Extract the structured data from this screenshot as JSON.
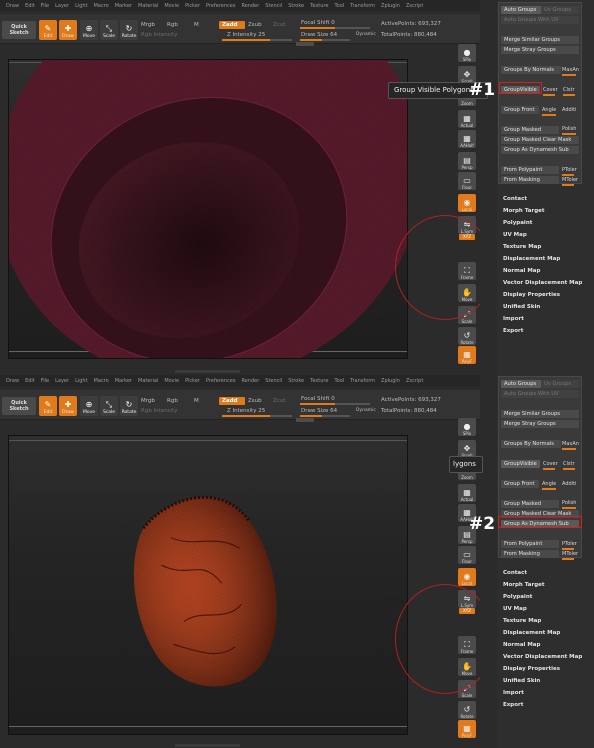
{
  "menu": [
    "Draw",
    "Edit",
    "File",
    "Layer",
    "Light",
    "Macro",
    "Marker",
    "Material",
    "Movie",
    "Picker",
    "Preferences",
    "Render",
    "Stencil",
    "Stroke",
    "Texture",
    "Tool",
    "Transform",
    "Zplugin",
    "Zscript"
  ],
  "toolbar": {
    "quick_sketch": "Quick Sketch",
    "edit": "Edit",
    "draw": "Draw",
    "move": "Move",
    "scale": "Scale",
    "rotate": "Rotate",
    "mrgb": "Mrgb",
    "rgb": "Rgb",
    "m": "M",
    "rgb_intensity": "Rgb Intensity",
    "zadd": "Zadd",
    "zsub": "Zsub",
    "zcut": "Zcut",
    "z_intensity": "Z Intensity 25",
    "focal_shift": "Focal Shift 0",
    "draw_size": "Draw Size 64",
    "dynamic": "Dynamic",
    "active_points": "ActivePoints: 693,327",
    "total_points": "TotalPoints: 880,484"
  },
  "right_shelf": {
    "spix": "SPix",
    "scroll": "Scroll",
    "zoom": "Zoom",
    "actual": "Actual",
    "aahalf": "AAHalf",
    "persp": "Persp",
    "floor": "Floor",
    "local": "Local",
    "lsym": "L.Sym",
    "xyz": "XYZ",
    "frame": "Frame",
    "move": "Move",
    "scale": "Scale",
    "rotate": "Rotate",
    "polyf": "PolyF"
  },
  "palette": {
    "auto_groups": "Auto Groups",
    "uv_groups": "Uv Groups",
    "auto_groups_uv": "Auto Groups With UV",
    "merge_similar": "Merge Similar Groups",
    "merge_stray": "Merge Stray Groups",
    "groups_by_normals": "Groups By Normals",
    "maxang": "MaxAn",
    "group_visible": "GroupVisible",
    "coverage": "Cover",
    "clst": "Clstr",
    "group_front": "Group Front",
    "angle": "Angle",
    "additive": "Additi",
    "group_masked": "Group Masked",
    "polish": "Polish",
    "group_masked_clear": "Group Masked Clear Mask",
    "group_as_dynamesh": "Group As Dynamesh Sub",
    "from_polypaint": "From Polypaint",
    "ptolerance": "PToler",
    "from_masking": "From Masking",
    "mtolerance": "MToler"
  },
  "subpalettes": [
    "Contact",
    "Morph Target",
    "Polypaint",
    "UV Map",
    "Texture Map",
    "Displacement Map",
    "Normal Map",
    "Vector Displacement Map",
    "Display Properties",
    "Unified Skin",
    "Import",
    "Export"
  ],
  "tooltip_top": "Group Visible Polygons",
  "tooltip_bottom": "lygons",
  "callout_1": "#1",
  "callout_2": "#2",
  "colors": {
    "accent": "#e07a1a",
    "highlight_box": "#e01919",
    "mesh": "#6b1f2b",
    "mesh_bottom": "#b5391a"
  }
}
